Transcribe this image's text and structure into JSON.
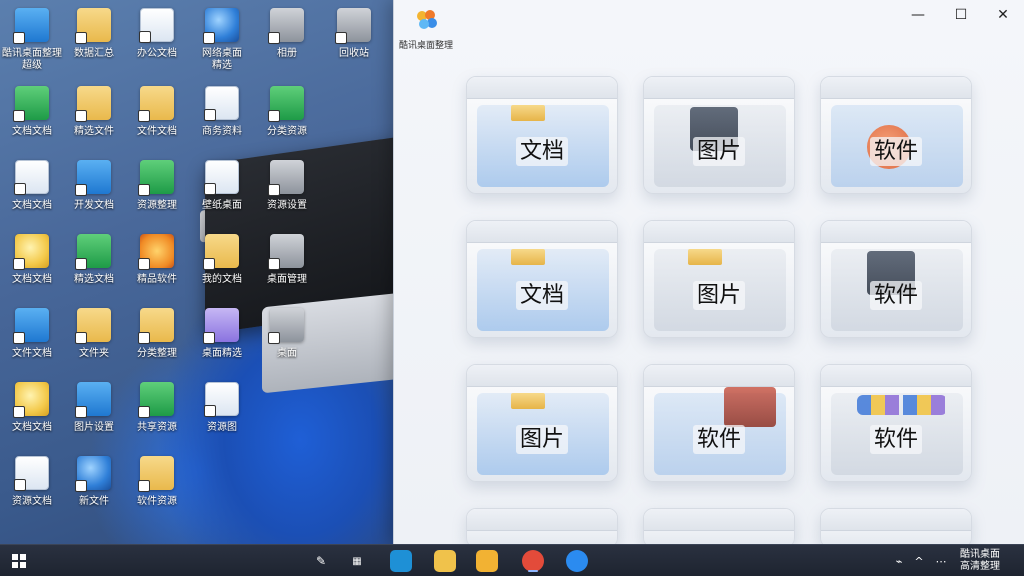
{
  "desktop": {
    "icons": [
      {
        "label": "酷讯桌面整理",
        "label2": "超级",
        "style": "g-blue"
      },
      {
        "label": "数据汇总",
        "label2": "",
        "style": "g-folder"
      },
      {
        "label": "办公文档",
        "label2": "",
        "style": "g-doc"
      },
      {
        "label": "网络桌面",
        "label2": "精选",
        "style": "g-globe"
      },
      {
        "label": "相册",
        "label2": "",
        "style": "g-gray"
      },
      {
        "label": "回收站",
        "label2": "",
        "style": "g-gray"
      },
      {
        "label": "文档文档",
        "label2": "",
        "style": "g-green"
      },
      {
        "label": "精选文件",
        "label2": "",
        "style": "g-folder"
      },
      {
        "label": "文件文档",
        "label2": "",
        "style": "g-folder"
      },
      {
        "label": "商务资料",
        "label2": "",
        "style": "g-doc"
      },
      {
        "label": "分类资源",
        "label2": "",
        "style": "g-green"
      },
      {
        "label": "文档文档",
        "label2": "",
        "style": "g-doc"
      },
      {
        "label": "开发文档",
        "label2": "",
        "style": "g-blue"
      },
      {
        "label": "资源整理",
        "label2": "",
        "style": "g-green"
      },
      {
        "label": "壁纸桌面",
        "label2": "",
        "style": "g-doc"
      },
      {
        "label": "资源设置",
        "label2": "",
        "style": "g-gray"
      },
      {
        "label": "文档文档",
        "label2": "",
        "style": "g-yellowball"
      },
      {
        "label": "精选文档",
        "label2": "",
        "style": "g-green"
      },
      {
        "label": "精品软件",
        "label2": "",
        "style": "g-star"
      },
      {
        "label": "我的文档",
        "label2": "",
        "style": "g-folder"
      },
      {
        "label": "桌面管理",
        "label2": "",
        "style": "g-gray"
      },
      {
        "label": "文件文档",
        "label2": "",
        "style": "g-blue"
      },
      {
        "label": "文件夹",
        "label2": "",
        "style": "g-folder"
      },
      {
        "label": "分类整理",
        "label2": "",
        "style": "g-folder"
      },
      {
        "label": "桌面精选",
        "label2": "",
        "style": "g-purple"
      },
      {
        "label": "桌面",
        "label2": "",
        "style": "g-gray"
      },
      {
        "label": "文档文档",
        "label2": "",
        "style": "g-yellowball"
      },
      {
        "label": "图片设置",
        "label2": "",
        "style": "g-blue"
      },
      {
        "label": "共享资源",
        "label2": "",
        "style": "g-green"
      },
      {
        "label": "资源图",
        "label2": "",
        "style": "g-doc"
      },
      {
        "label": "资源文档",
        "label2": "",
        "style": "g-doc"
      },
      {
        "label": "新文件",
        "label2": "",
        "style": "g-globe"
      },
      {
        "label": "软件资源",
        "label2": "",
        "style": "g-folder"
      }
    ]
  },
  "panel": {
    "app_title": "酷讯桌面整理",
    "window_controls": {
      "minimize": "—",
      "maximize": "☐",
      "close": "✕"
    },
    "boxes": [
      {
        "label": "文档",
        "kind": "docs",
        "deco": "folder"
      },
      {
        "label": "图片",
        "kind": "pics",
        "deco": "dark"
      },
      {
        "label": "软件",
        "kind": "soft",
        "deco": "orange"
      },
      {
        "label": "文档",
        "kind": "docs",
        "deco": "folder"
      },
      {
        "label": "图片",
        "kind": "pics",
        "deco": "folder"
      },
      {
        "label": "软件",
        "kind": "pics",
        "deco": "dark"
      },
      {
        "label": "图片",
        "kind": "docs",
        "deco": "folder"
      },
      {
        "label": "软件",
        "kind": "soft",
        "deco": "red"
      },
      {
        "label": "软件",
        "kind": "pics",
        "deco": "gear"
      }
    ]
  },
  "taskbar": {
    "apps": [
      {
        "name": "edge",
        "color": "#1e90d6"
      },
      {
        "name": "notes",
        "color": "#f0c24b"
      },
      {
        "name": "explorer",
        "color": "#f2b233"
      },
      {
        "name": "chrome",
        "color": "#e34b3a"
      },
      {
        "name": "browser",
        "color": "#2b8bf0"
      }
    ],
    "tray_text_line1": "酷讯桌面",
    "tray_text_line2": "高清整理"
  },
  "colors": {
    "accent": "#2b8bf0",
    "taskbar": "#1e2430"
  }
}
